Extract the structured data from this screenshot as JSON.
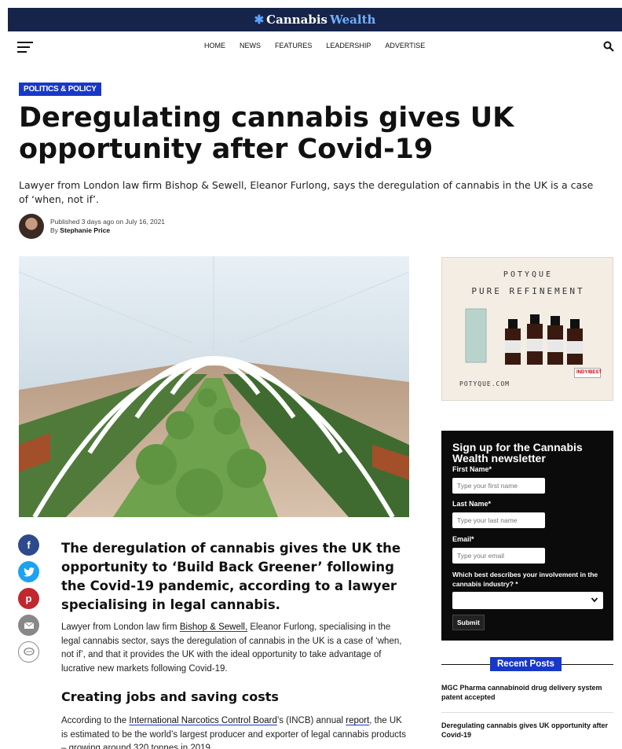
{
  "site": {
    "logo_main": "Cannabis",
    "logo_accent": "Wealth"
  },
  "nav": {
    "items": [
      "HOME",
      "NEWS",
      "FEATURES",
      "LEADERSHIP",
      "ADVERTISE"
    ]
  },
  "article": {
    "category": "POLITICS & POLICY",
    "headline": "Deregulating cannabis gives UK opportunity after Covid-19",
    "subtitle": "Lawyer from London law firm Bishop & Sewell, Eleanor Furlong, says the deregulation of cannabis in the UK is a case of ‘when, not if’.",
    "published": "Published 3 days ago on July 16, 2021",
    "by_prefix": "By",
    "author": "Stephanie Price",
    "lede": "The deregulation of cannabis gives the UK the opportunity to ‘Build Back Greener’ following the Covid-19 pandemic, according to a lawyer specialising in legal cannabis.",
    "para1_a": "Lawyer from London law firm ",
    "para1_link": "Bishop & Sewell,",
    "para1_b": " Eleanor Furlong, specialising in the legal cannabis sector, says the deregulation of cannabis in the UK is a case of ‘when, not if’, and that it provides the UK with the ideal opportunity to take advantage of lucrative new markets following Covid-19.",
    "subhead": "Creating jobs and saving costs",
    "para2_a": "According to the ",
    "para2_link1": "International Narcotics Control Board",
    "para2_b": "’s (INCB) annual ",
    "para2_link2": "report",
    "para2_c": ", the UK is estimated to be the world’s largest producer and exporter of legal cannabis products – growing around 320 tonnes in 2019."
  },
  "share": {
    "facebook": "f",
    "twitter": "t",
    "pinterest": "p"
  },
  "ad": {
    "brand": "POTYQUE",
    "tagline": "PURE REFINEMENT",
    "url": "POTYQUE.COM",
    "badge": "INDY/BEST"
  },
  "newsletter": {
    "title": "Sign up for the Cannabis Wealth newsletter",
    "first_label": "First Name*",
    "first_placeholder": "Type your first name",
    "last_label": "Last Name*",
    "last_placeholder": "Type your last name",
    "email_label": "Email*",
    "email_placeholder": "Type your email",
    "involvement_label": "Which best describes your involvement in the cannabis industry? *",
    "submit": "Submit"
  },
  "recent": {
    "title": "Recent Posts",
    "items": [
      "MGC Pharma cannabinoid drug delivery system patent accepted",
      "Deregulating cannabis gives UK opportunity after Covid-19"
    ]
  },
  "colors": {
    "nav_bg": "#16244a",
    "accent": "#1838c8",
    "newsletter_bg": "#0b0b0b"
  }
}
